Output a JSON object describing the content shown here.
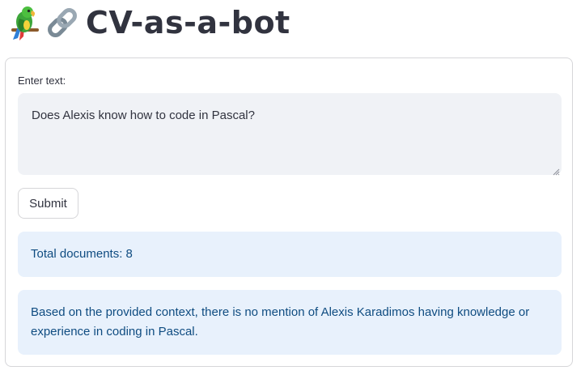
{
  "header": {
    "title": "CV-as-a-bot",
    "icons": [
      "parrot-icon",
      "link-icon"
    ]
  },
  "form": {
    "label": "Enter text:",
    "input_value": "Does Alexis know how to code in Pascal?",
    "submit_label": "Submit"
  },
  "results": {
    "count_text": "Total documents: 8",
    "answer_text": "Based on the provided context, there is no mention of Alexis Karadimos having knowledge or experience in coding in Pascal."
  },
  "colors": {
    "text": "#31333f",
    "input_bg": "#f0f2f6",
    "info_bg": "#e8f1fc",
    "info_text": "#0f4c81",
    "border": "#d6d6d9"
  }
}
